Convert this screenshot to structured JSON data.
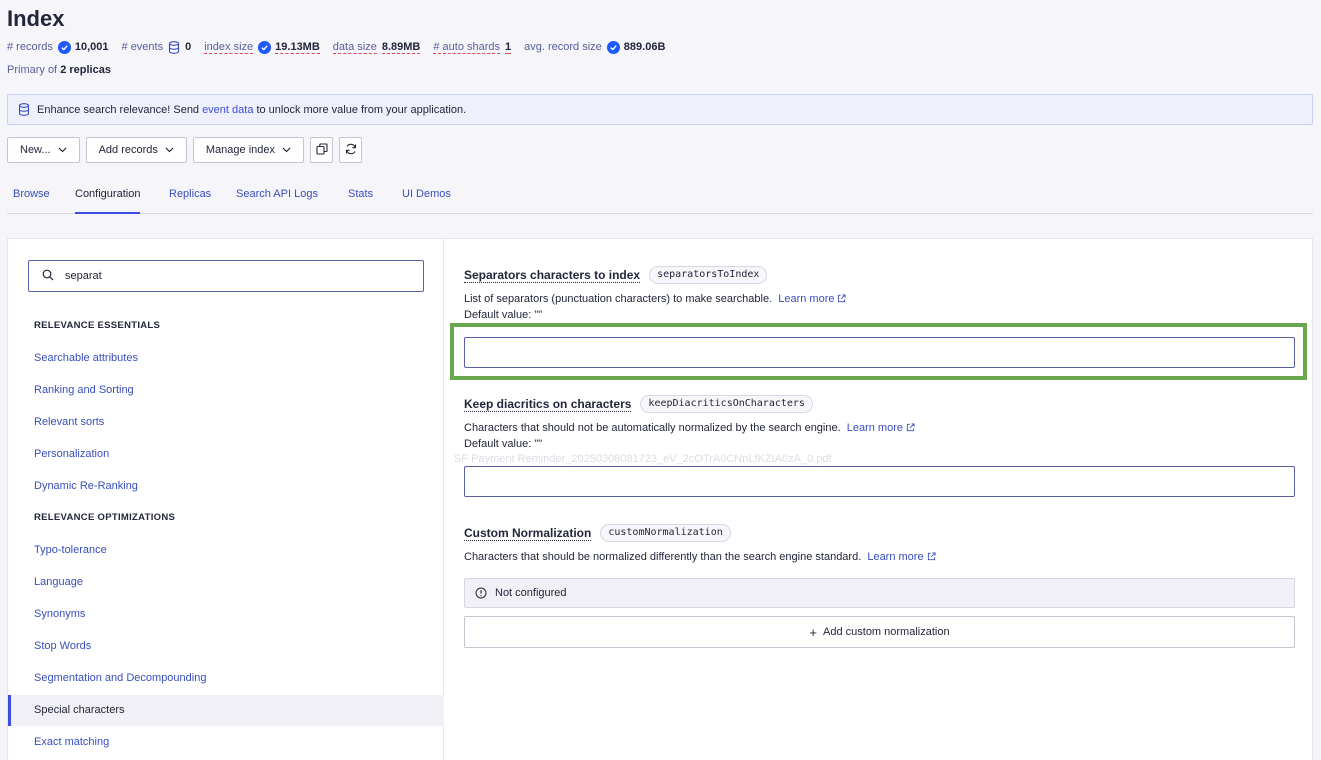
{
  "page": {
    "title": "Index"
  },
  "stats": {
    "records_label": "# records",
    "records_value": "10,001",
    "events_label": "# events",
    "events_value": "0",
    "index_size_label": "index size",
    "index_size_value": "19.13MB",
    "data_size_label": "data size",
    "data_size_value": "8.89MB",
    "auto_shards_label": "# auto shards",
    "auto_shards_value": "1",
    "avg_record_label": "avg. record size",
    "avg_record_value": "889.06B"
  },
  "replicas": {
    "prefix": "Primary of",
    "value": "2 replicas"
  },
  "banner": {
    "before": "Enhance search relevance! Send",
    "link": "event data",
    "after": "to unlock more value from your application."
  },
  "toolbar": {
    "new_label": "New...",
    "add_records_label": "Add records",
    "manage_index_label": "Manage index"
  },
  "tabs": [
    {
      "label": "Browse"
    },
    {
      "label": "Configuration"
    },
    {
      "label": "Replicas"
    },
    {
      "label": "Search API Logs"
    },
    {
      "label": "Stats"
    },
    {
      "label": "UI Demos"
    }
  ],
  "search": {
    "value": "separat"
  },
  "sidebar": {
    "section1": "RELEVANCE ESSENTIALS",
    "section2": "RELEVANCE OPTIMIZATIONS",
    "items": [
      {
        "label": "Searchable attributes"
      },
      {
        "label": "Ranking and Sorting"
      },
      {
        "label": "Relevant sorts"
      },
      {
        "label": "Personalization"
      },
      {
        "label": "Dynamic Re-Ranking"
      },
      {
        "label": "Typo-tolerance"
      },
      {
        "label": "Language"
      },
      {
        "label": "Synonyms"
      },
      {
        "label": "Stop Words"
      },
      {
        "label": "Segmentation and Decompounding"
      },
      {
        "label": "Special characters"
      },
      {
        "label": "Exact matching"
      }
    ]
  },
  "settings": {
    "separators": {
      "title": "Separators characters to index",
      "code": "separatorsToIndex",
      "description": "List of separators (punctuation characters) to make searchable.",
      "learn_more": "Learn more",
      "default": "Default value: \"\""
    },
    "diacritics": {
      "title": "Keep diacritics on characters",
      "code": "keepDiacriticsOnCharacters",
      "description": "Characters that should not be automatically normalized by the search engine.",
      "learn_more": "Learn more",
      "default": "Default value: \"\""
    },
    "normalization": {
      "title": "Custom Normalization",
      "code": "customNormalization",
      "description": "Characters that should be normalized differently than the search engine standard.",
      "learn_more": "Learn more",
      "status": "Not configured",
      "add_label": "Add custom normalization"
    }
  },
  "overlay": {
    "ghost_text": "SF Payment Reminder_20250308081723_eV_2cOTrA0CNnLfKZIA0zA_0.pdf"
  },
  "colors": {
    "accent": "#3c4fe0",
    "highlight": "#6aa84f",
    "check": "#1e59ff"
  }
}
